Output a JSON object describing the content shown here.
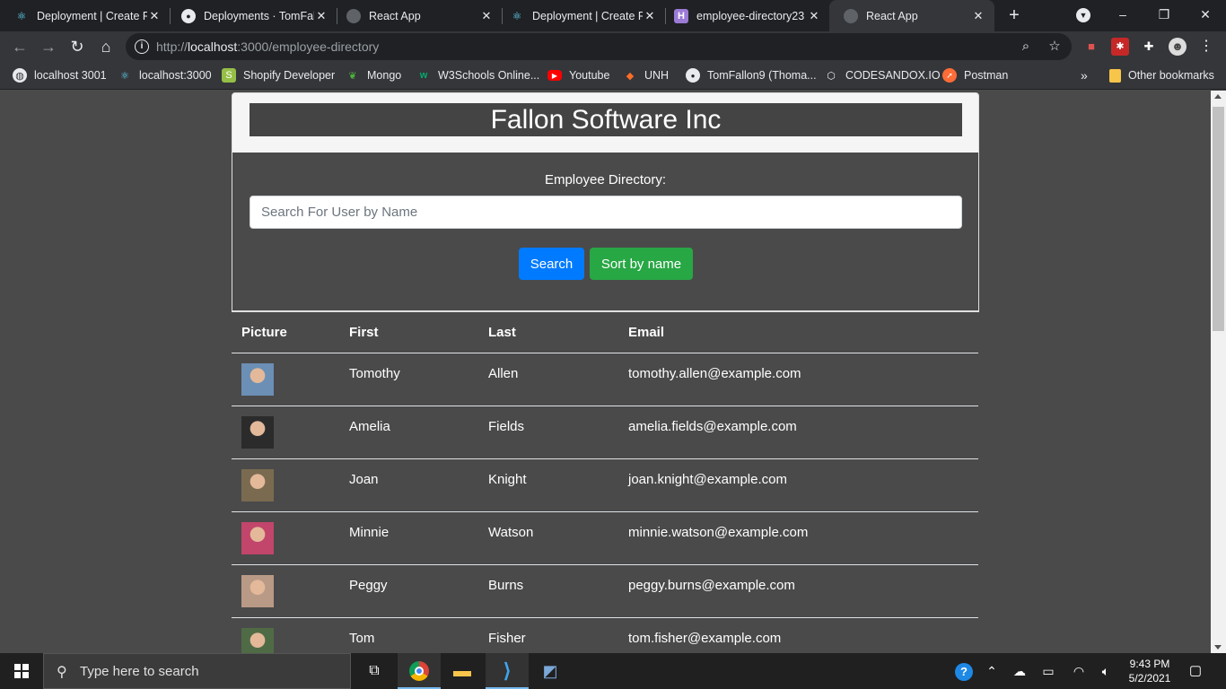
{
  "browser": {
    "tabs": [
      {
        "title": "Deployment | Create R",
        "icon": "react-icon",
        "active": false
      },
      {
        "title": "Deployments · TomFall",
        "icon": "github-icon",
        "active": false
      },
      {
        "title": "React App",
        "icon": "globe-icon",
        "active": false
      },
      {
        "title": "Deployment | Create R",
        "icon": "react-icon",
        "active": false
      },
      {
        "title": "employee-directory23",
        "icon": "heroku-icon",
        "active": false
      },
      {
        "title": "React App",
        "icon": "globe-icon",
        "active": true
      }
    ],
    "url_prefix": "http://",
    "url_host": "localhost",
    "url_rest": ":3000/employee-directory",
    "bookmarks": [
      {
        "label": "localhost 3001",
        "icon": "globe-icon"
      },
      {
        "label": "localhost:3000",
        "icon": "react-icon"
      },
      {
        "label": "Shopify Developer",
        "icon": "shopify-icon"
      },
      {
        "label": "Mongo",
        "icon": "mongo-leaf-icon"
      },
      {
        "label": "W3Schools Online...",
        "icon": "w3schools-icon"
      },
      {
        "label": "Youtube",
        "icon": "youtube-icon"
      },
      {
        "label": "UNH",
        "icon": "gitlab-icon"
      },
      {
        "label": "TomFallon9 (Thoma...",
        "icon": "github-icon"
      },
      {
        "label": "CODESANDOX.IO",
        "icon": "codesandbox-icon"
      },
      {
        "label": "Postman",
        "icon": "postman-icon"
      }
    ],
    "more_bookmarks": "»",
    "other_bookmarks": "Other bookmarks"
  },
  "page": {
    "company": "Fallon Software Inc",
    "directory_label": "Employee Directory:",
    "search_placeholder": "Search For User by Name",
    "search_button": "Search",
    "sort_button": "Sort by name",
    "columns": [
      "Picture",
      "First",
      "Last",
      "Email"
    ],
    "employees": [
      {
        "first": "Tomothy",
        "last": "Allen",
        "email": "tomothy.allen@example.com",
        "avatar_color": "#6b8fb5"
      },
      {
        "first": "Amelia",
        "last": "Fields",
        "email": "amelia.fields@example.com",
        "avatar_color": "#2b2b2b"
      },
      {
        "first": "Joan",
        "last": "Knight",
        "email": "joan.knight@example.com",
        "avatar_color": "#7a6a4f"
      },
      {
        "first": "Minnie",
        "last": "Watson",
        "email": "minnie.watson@example.com",
        "avatar_color": "#c2456b"
      },
      {
        "first": "Peggy",
        "last": "Burns",
        "email": "peggy.burns@example.com",
        "avatar_color": "#b89a86"
      },
      {
        "first": "Tom",
        "last": "Fisher",
        "email": "tom.fisher@example.com",
        "avatar_color": "#4f6b45"
      }
    ]
  },
  "taskbar": {
    "search_placeholder": "Type here to search",
    "time": "9:43 PM",
    "date": "5/2/2021"
  }
}
